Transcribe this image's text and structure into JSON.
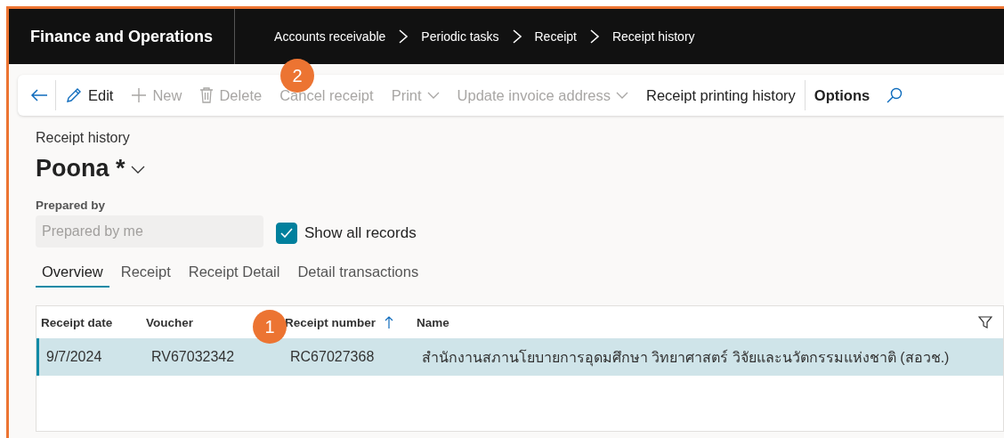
{
  "app": {
    "title": "Finance and Operations"
  },
  "breadcrumbs": [
    "Accounts receivable",
    "Periodic tasks",
    "Receipt",
    "Receipt history"
  ],
  "toolbar": [
    {
      "kind": "back"
    },
    {
      "kind": "edit",
      "label": "Edit",
      "disabled": false
    },
    {
      "kind": "new",
      "label": "New",
      "disabled": true
    },
    {
      "kind": "delete",
      "label": "Delete",
      "disabled": true
    },
    {
      "kind": "text",
      "label": "Cancel receipt",
      "disabled": true
    },
    {
      "kind": "menu",
      "label": "Print",
      "disabled": true
    },
    {
      "kind": "menu",
      "label": "Update invoice address",
      "disabled": true
    },
    {
      "kind": "text",
      "label": "Receipt printing history",
      "disabled": false
    },
    {
      "kind": "options",
      "label": "Options",
      "disabled": false
    },
    {
      "kind": "search"
    }
  ],
  "page": {
    "caption": "Receipt history",
    "view_name": "Poona *"
  },
  "filter": {
    "label": "Prepared by",
    "placeholder": "Prepared by me"
  },
  "show_all": {
    "label": "Show all records",
    "checked": true
  },
  "tabs": [
    {
      "label": "Overview",
      "selected": true
    },
    {
      "label": "Receipt",
      "selected": false
    },
    {
      "label": "Receipt Detail",
      "selected": false
    },
    {
      "label": "Detail transactions",
      "selected": false
    }
  ],
  "table": {
    "columns": [
      {
        "label": "Receipt date",
        "sorted": false
      },
      {
        "label": "Voucher",
        "sorted": false
      },
      {
        "label": "Receipt number",
        "sorted": true
      },
      {
        "label": "Name",
        "sorted": false
      }
    ],
    "rows": [
      {
        "selected": true,
        "cells": [
          "9/7/2024",
          "RV67032342",
          "RC67027368",
          "สำนักงานสภานโยบายการอุดมศึกษา วิทยาศาสตร์ วิจัยและนวัตกรรมแห่งชาติ (สอวช.)"
        ]
      }
    ]
  },
  "annotations": [
    {
      "label": "2"
    },
    {
      "label": "1"
    }
  ]
}
